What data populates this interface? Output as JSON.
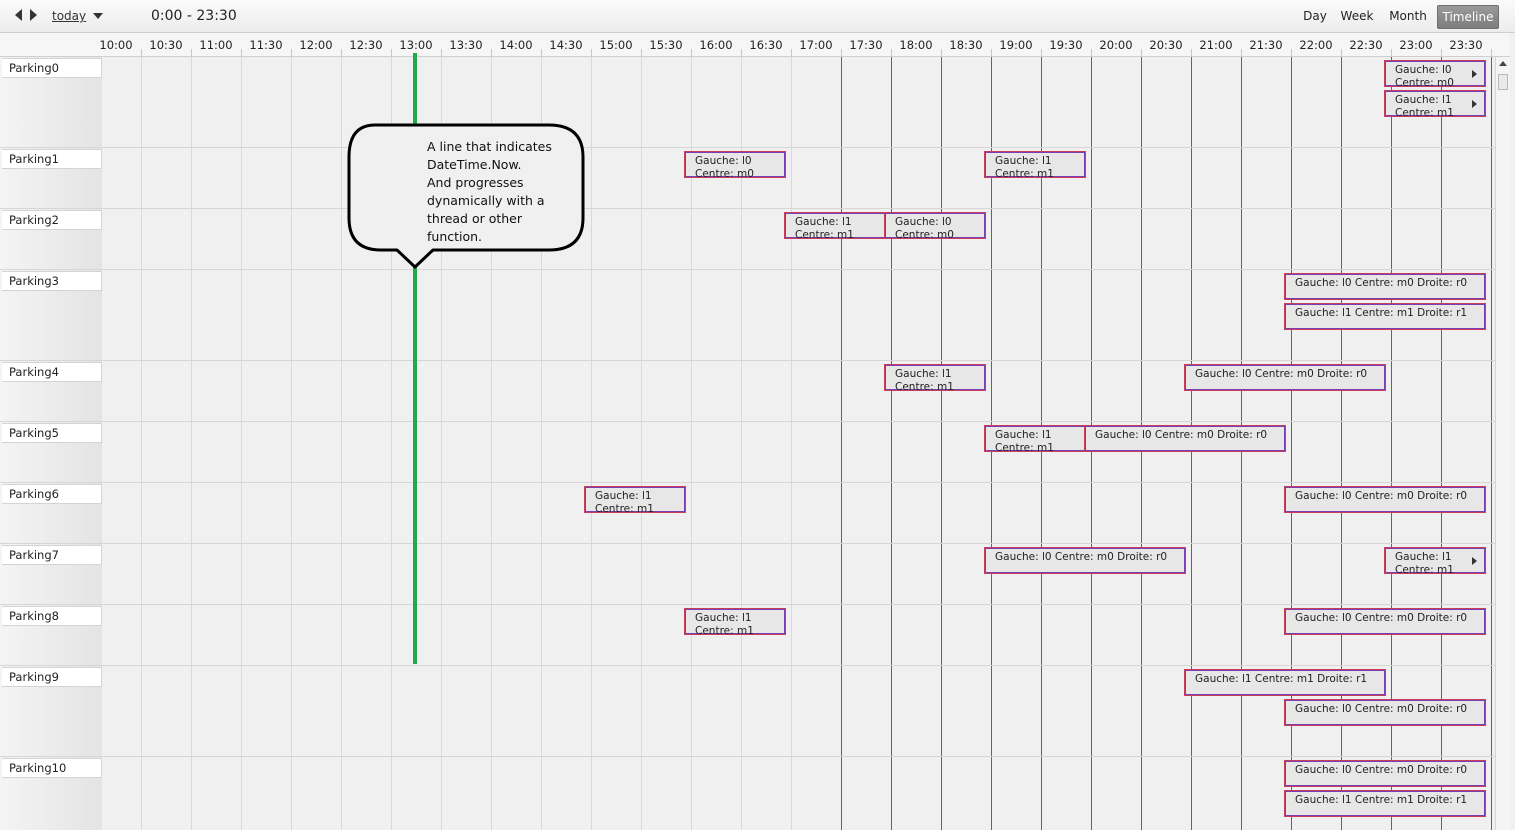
{
  "toolbar": {
    "today_label": "today",
    "range_label": "0:00 - 23:30",
    "views": [
      {
        "label": "Day",
        "active": false
      },
      {
        "label": "Week",
        "active": false
      },
      {
        "label": "Month",
        "active": false
      },
      {
        "label": "Timeline",
        "active": true
      }
    ]
  },
  "timeline": {
    "ticks": [
      "10:00",
      "10:30",
      "11:00",
      "11:30",
      "12:00",
      "12:30",
      "13:00",
      "13:30",
      "14:00",
      "14:30",
      "15:00",
      "15:30",
      "16:00",
      "16:30",
      "17:00",
      "17:30",
      "18:00",
      "18:30",
      "19:00",
      "19:30",
      "20:00",
      "20:30",
      "21:00",
      "21:30",
      "22:00",
      "22:30",
      "23:00",
      "23:30"
    ],
    "marker_times": [
      "17:30",
      "18:00",
      "18:30",
      "19:00",
      "19:30",
      "20:00",
      "20:30",
      "21:00",
      "21:30",
      "22:00",
      "22:30",
      "23:00",
      "23:30",
      "24:00"
    ],
    "now": "13:00"
  },
  "rows": [
    {
      "label": "Parking0",
      "lanes": 2,
      "events": [
        {
          "start": "23:00",
          "end": "24:00",
          "lane": 0,
          "text": "Gauche: l0\nCentre: m0",
          "more": true
        },
        {
          "start": "23:00",
          "end": "24:00",
          "lane": 1,
          "text": "Gauche: l1\nCentre: m1",
          "more": true
        }
      ]
    },
    {
      "label": "Parking1",
      "lanes": 1,
      "events": [
        {
          "start": "16:00",
          "end": "17:00",
          "lane": 0,
          "text": "Gauche: l0\nCentre: m0"
        },
        {
          "start": "19:00",
          "end": "20:00",
          "lane": 0,
          "text": "Gauche: l1\nCentre: m1"
        }
      ]
    },
    {
      "label": "Parking2",
      "lanes": 1,
      "events": [
        {
          "start": "17:00",
          "end": "18:00",
          "lane": 0,
          "text": "Gauche: l1\nCentre: m1"
        },
        {
          "start": "18:00",
          "end": "19:00",
          "lane": 0,
          "text": "Gauche: l0\nCentre: m0"
        }
      ]
    },
    {
      "label": "Parking3",
      "lanes": 2,
      "events": [
        {
          "start": "22:00",
          "end": "24:00",
          "lane": 0,
          "text": "Gauche: l0 Centre: m0 Droite: r0"
        },
        {
          "start": "22:00",
          "end": "24:00",
          "lane": 1,
          "text": "Gauche: l1 Centre: m1 Droite: r1"
        }
      ]
    },
    {
      "label": "Parking4",
      "lanes": 1,
      "events": [
        {
          "start": "18:00",
          "end": "19:00",
          "lane": 0,
          "text": "Gauche: l1\nCentre: m1"
        },
        {
          "start": "21:00",
          "end": "23:00",
          "lane": 0,
          "text": "Gauche: l0 Centre: m0 Droite: r0"
        }
      ]
    },
    {
      "label": "Parking5",
      "lanes": 1,
      "events": [
        {
          "start": "19:00",
          "end": "20:00",
          "lane": 0,
          "text": "Gauche: l1\nCentre: m1"
        },
        {
          "start": "20:00",
          "end": "22:00",
          "lane": 0,
          "text": "Gauche: l0 Centre: m0 Droite: r0"
        }
      ]
    },
    {
      "label": "Parking6",
      "lanes": 1,
      "events": [
        {
          "start": "15:00",
          "end": "16:00",
          "lane": 0,
          "text": "Gauche: l1\nCentre: m1"
        },
        {
          "start": "22:00",
          "end": "24:00",
          "lane": 0,
          "text": "Gauche: l0 Centre: m0 Droite: r0"
        }
      ]
    },
    {
      "label": "Parking7",
      "lanes": 1,
      "events": [
        {
          "start": "19:00",
          "end": "21:00",
          "lane": 0,
          "text": "Gauche: l0 Centre: m0 Droite: r0"
        },
        {
          "start": "23:00",
          "end": "24:00",
          "lane": 0,
          "text": "Gauche: l1\nCentre: m1",
          "more": true
        }
      ]
    },
    {
      "label": "Parking8",
      "lanes": 1,
      "events": [
        {
          "start": "16:00",
          "end": "17:00",
          "lane": 0,
          "text": "Gauche: l1\nCentre: m1"
        },
        {
          "start": "22:00",
          "end": "24:00",
          "lane": 0,
          "text": "Gauche: l0 Centre: m0 Droite: r0"
        }
      ]
    },
    {
      "label": "Parking9",
      "lanes": 2,
      "events": [
        {
          "start": "21:00",
          "end": "23:00",
          "lane": 0,
          "text": "Gauche: l1 Centre: m1 Droite: r1"
        },
        {
          "start": "22:00",
          "end": "24:00",
          "lane": 1,
          "text": "Gauche: l0 Centre: m0 Droite: r0"
        }
      ]
    },
    {
      "label": "Parking10",
      "lanes": 2,
      "events": [
        {
          "start": "22:00",
          "end": "24:00",
          "lane": 0,
          "text": "Gauche: l0 Centre: m0 Droite: r0"
        },
        {
          "start": "22:00",
          "end": "24:00",
          "lane": 1,
          "text": "Gauche: l1 Centre: m1 Droite: r1"
        }
      ]
    }
  ],
  "annotation": {
    "text": "A line that indicates\nDateTime.Now.\nAnd progresses\ndynamically with a\nthread or other\nfunction.",
    "color": "#23a84a"
  },
  "colors": {
    "marker_line": "#d43434",
    "event_border": "#c93d5c",
    "now_line": "#23a84a"
  }
}
